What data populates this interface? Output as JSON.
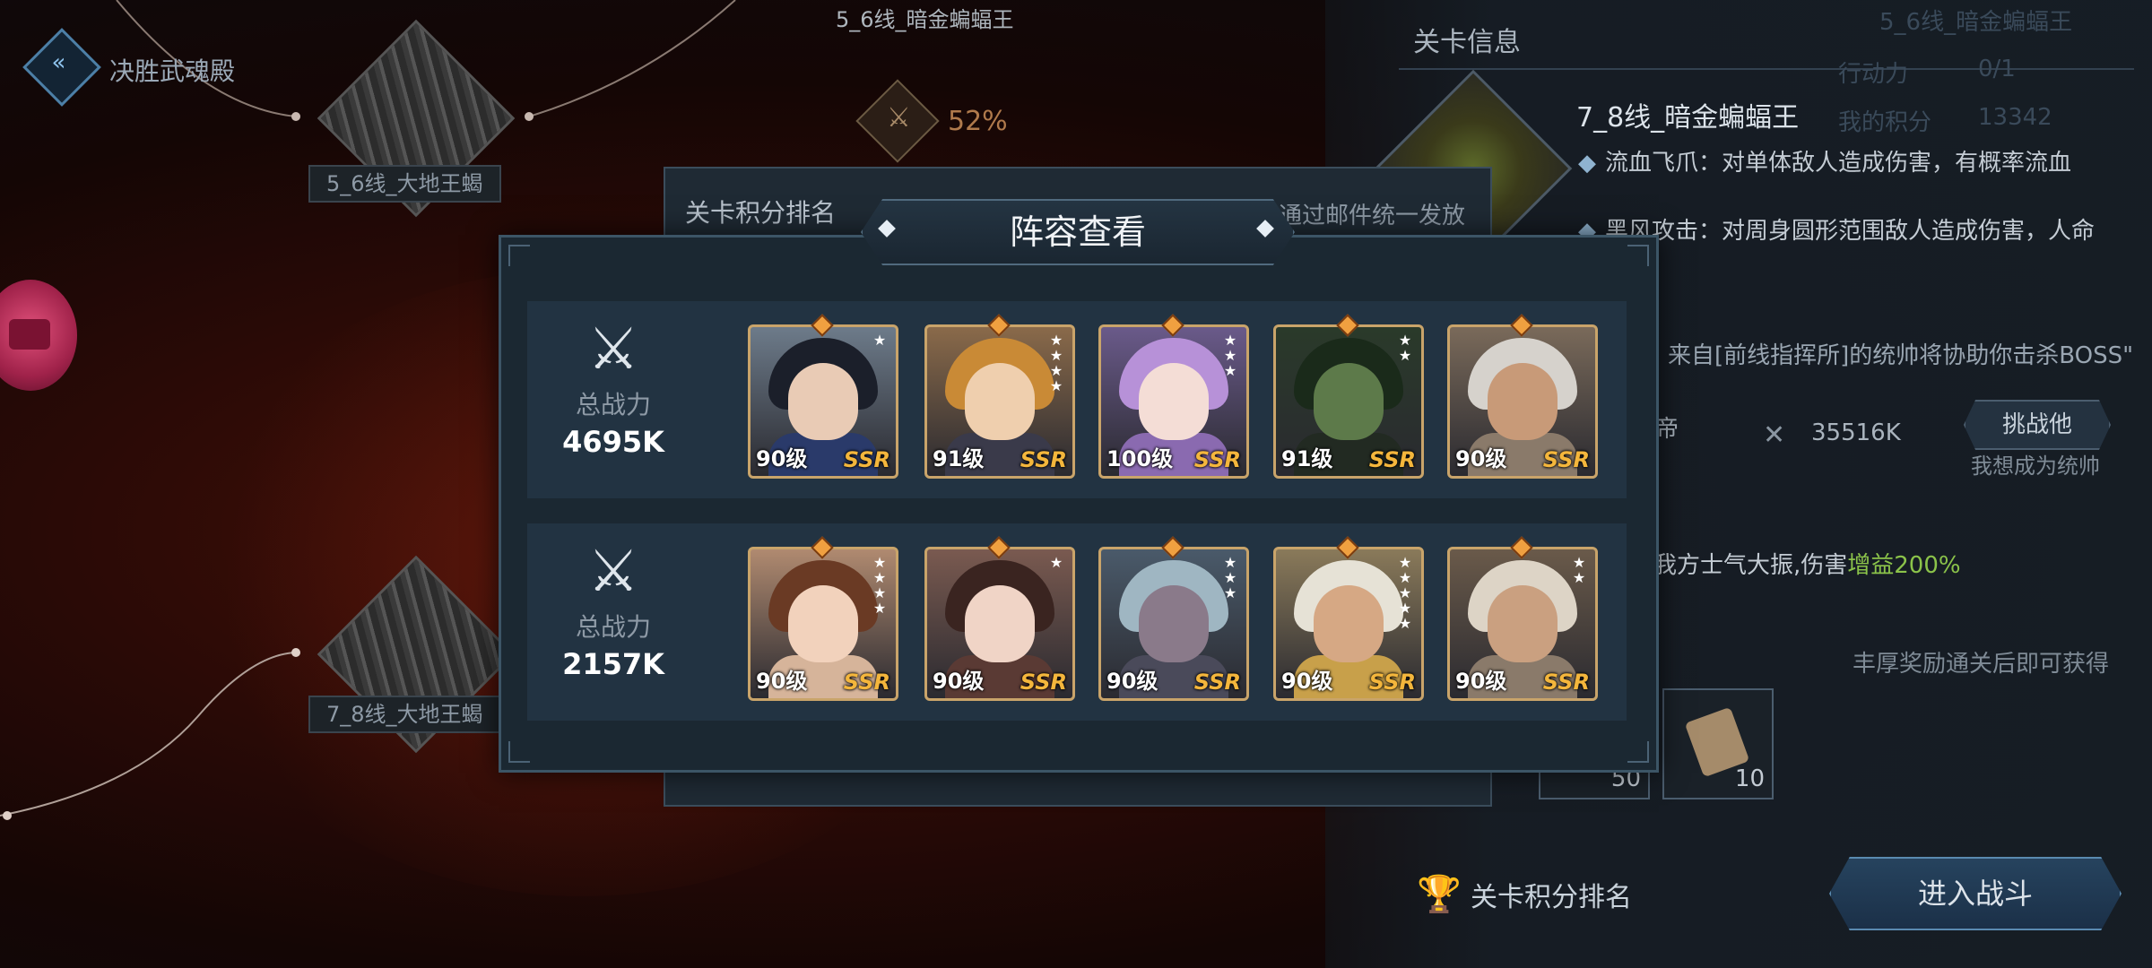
{
  "map": {
    "back_label": "决胜武魂殿",
    "node_top_label": "5_6线_暗金蝙蝠王",
    "node1_label": "5_6线_大地王蝎",
    "node2_label": "7_8线_大地王蝎",
    "progress_percent": "52%"
  },
  "stage_info": {
    "title": "关卡信息",
    "faded_title": "5_6线_暗金蝙蝠王",
    "faded_row1": "行动力",
    "faded_row1_value": "0/1",
    "faded_row2": "我的积分",
    "faded_row2_value": "13342",
    "boss_name": "7_8线_暗金蝙蝠王",
    "skill1": "流血飞爪：对单体敌人造成伤害，有概率流血",
    "skill2": "黑风攻击：对周身圆形范围敌人造成伤害，人命中下降",
    "help_text": "来自[前线指挥所]的统帅将协助你击杀BOSS\"",
    "ally_name": "帝",
    "ally_power": "35516K",
    "challenge_label": "挑战他",
    "want_text": "我想成为统帅",
    "morale_prefix": "我方士气大振,伤害",
    "morale_bonus": "增益200%",
    "reward_text": "丰厚奖励通关后即可获得",
    "reward_counts": [
      "50",
      "10"
    ],
    "rank_label": "关卡积分排名",
    "enter_label": "进入战斗"
  },
  "rank_panel": {
    "title": "关卡积分排名",
    "note": "通过邮件统一发放"
  },
  "modal": {
    "title": "阵容查看",
    "teams": [
      {
        "power_label": "总战力",
        "power_value": "4695K",
        "heroes": [
          {
            "level": "90级",
            "rarity": "SSR",
            "stars": 1,
            "hair": "#1b1f2a",
            "skin": "#e9cbb5",
            "cloth": "#2a3a6a",
            "bg": "#6d7b8a"
          },
          {
            "level": "91级",
            "rarity": "SSR",
            "stars": 4,
            "hair": "#c98a36",
            "skin": "#efcfae",
            "cloth": "#3a3a4a",
            "bg": "#8a6a4a"
          },
          {
            "level": "100级",
            "rarity": "SSR",
            "stars": 3,
            "hair": "#b791d8",
            "skin": "#f4ddd6",
            "cloth": "#8a6ab0",
            "bg": "#6a5a8a"
          },
          {
            "level": "91级",
            "rarity": "SSR",
            "stars": 2,
            "hair": "#1a2a1a",
            "skin": "#5d7a4a",
            "cloth": "#222a22",
            "bg": "#2a3a2a"
          },
          {
            "level": "90级",
            "rarity": "SSR",
            "stars": 0,
            "hair": "#d6d2cc",
            "skin": "#c89a78",
            "cloth": "#8a7a6a",
            "bg": "#7a6a5a"
          }
        ]
      },
      {
        "power_label": "总战力",
        "power_value": "2157K",
        "heroes": [
          {
            "level": "90级",
            "rarity": "SSR",
            "stars": 4,
            "hair": "#6a3a24",
            "skin": "#f2d2bc",
            "cloth": "#d6b49a",
            "bg": "#b08a70"
          },
          {
            "level": "90级",
            "rarity": "SSR",
            "stars": 1,
            "hair": "#3a2420",
            "skin": "#f0d4c6",
            "cloth": "#5a3a34",
            "bg": "#7a5a50"
          },
          {
            "level": "90级",
            "rarity": "SSR",
            "stars": 3,
            "hair": "#9fb6c2",
            "skin": "#8a7a8a",
            "cloth": "#4a4a5a",
            "bg": "#4a5a6a"
          },
          {
            "level": "90级",
            "rarity": "SSR",
            "stars": 5,
            "hair": "#e6e2d6",
            "skin": "#d6a884",
            "cloth": "#c8a04a",
            "bg": "#8a7a5a"
          },
          {
            "level": "90级",
            "rarity": "SSR",
            "stars": 2,
            "hair": "#ddd4c6",
            "skin": "#caa080",
            "cloth": "#8a7a6a",
            "bg": "#6a5a4a"
          }
        ]
      }
    ]
  },
  "colors": {
    "accent_gold": "#c9a46a",
    "ssr": "#f4b63c",
    "bonus_green": "#8bc34a",
    "bg_red": "#4a1108"
  }
}
